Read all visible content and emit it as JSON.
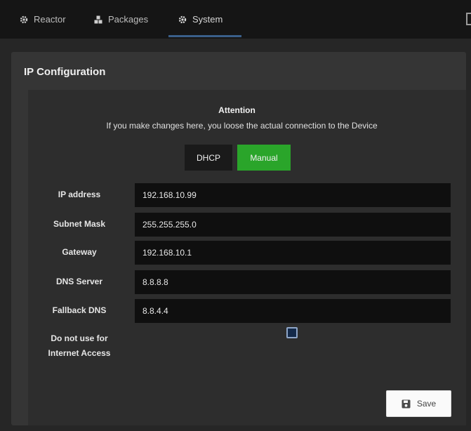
{
  "nav": {
    "tabs": [
      {
        "label": "Reactor",
        "icon": "gear-icon"
      },
      {
        "label": "Packages",
        "icon": "boxes-icon"
      },
      {
        "label": "System",
        "icon": "gear-icon",
        "active": true
      }
    ]
  },
  "panel": {
    "title": "IP Configuration",
    "attention_title": "Attention",
    "attention_text": "If you make changes here, you loose the actual connection to the Device",
    "mode": {
      "dhcp_label": "DHCP",
      "manual_label": "Manual",
      "selected": "Manual"
    },
    "fields": {
      "ip_label": "IP address",
      "ip_value": "192.168.10.99",
      "subnet_label": "Subnet Mask",
      "subnet_value": "255.255.255.0",
      "gateway_label": "Gateway",
      "gateway_value": "192.168.10.1",
      "dns_label": "DNS Server",
      "dns_value": "8.8.8.8",
      "fallback_label": "Fallback DNS",
      "fallback_value": "8.8.4.4"
    },
    "no_internet_label_line1": "Do not use for",
    "no_internet_label_line2": "Internet Access",
    "no_internet_checked": false,
    "save_label": "Save"
  },
  "colors": {
    "accent_green": "#2aa52a",
    "active_tab_underline": "#3a5f8a"
  }
}
